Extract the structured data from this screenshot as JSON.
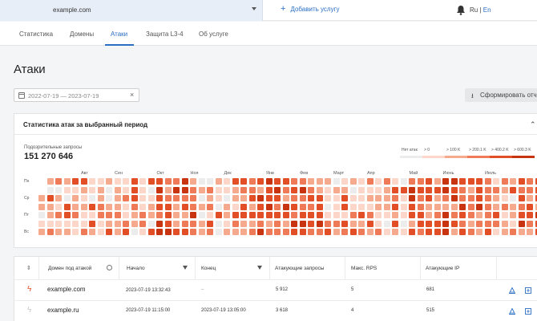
{
  "topbar": {
    "domain_value": "example.com",
    "add_service": "Добавить услугу",
    "lang_ru": "Ru",
    "lang_sep": "|",
    "lang_en": "En"
  },
  "tabs": [
    {
      "label": "Статистика"
    },
    {
      "label": "Домены"
    },
    {
      "label": "Атаки",
      "active": true
    },
    {
      "label": "Защита L3-4"
    },
    {
      "label": "Об услуге"
    }
  ],
  "page_title": "Атаки",
  "date_range": "2022-07-19 — 2023-07-19",
  "report_button": "Сформировать отч",
  "stats": {
    "title": "Статистика атак за выбранный период",
    "suspicious_label": "Подозрительные запросы",
    "suspicious_value": "151 270 646",
    "legend": [
      {
        "label": "Нет атак",
        "color": "#ececec"
      },
      {
        "label": "> 0",
        "color": "#fbd6c9"
      },
      {
        "label": "> 100 K",
        "color": "#f5a98d"
      },
      {
        "label": "> 200.1 K",
        "color": "#ef7a57"
      },
      {
        "label": "> 400.2 K",
        "color": "#e24f26"
      },
      {
        "label": "> 600.3 K",
        "color": "#c8340f"
      }
    ],
    "months": [
      "Авг",
      "Сен",
      "Окт",
      "Ноя",
      "Дек",
      "Янв",
      "Фев",
      "Март",
      "Апр",
      "Май",
      "Июнь",
      "Июль"
    ],
    "day_labels": [
      "Пн",
      "Ср",
      "Пт",
      "Вс"
    ]
  },
  "table": {
    "headers": [
      "Домен под атакой",
      "Начало",
      "Конец",
      "Атакующие запросы",
      "Макс. RPS",
      "Атакующие IP"
    ],
    "rows": [
      {
        "domain": "example.com",
        "start": "2023-07-19 13:32:43",
        "end": "–",
        "requests": "5 912",
        "rps": "5",
        "ips": "681",
        "active": true
      },
      {
        "domain": "example.ru",
        "start": "2023-07-19 11:15:00",
        "end": "2023-07-19 13:05:00",
        "requests": "3 618",
        "rps": "4",
        "ips": "515",
        "active": false
      }
    ]
  },
  "colors": {
    "accent": "#2b6fc4",
    "attack_active": "#e24f26"
  }
}
